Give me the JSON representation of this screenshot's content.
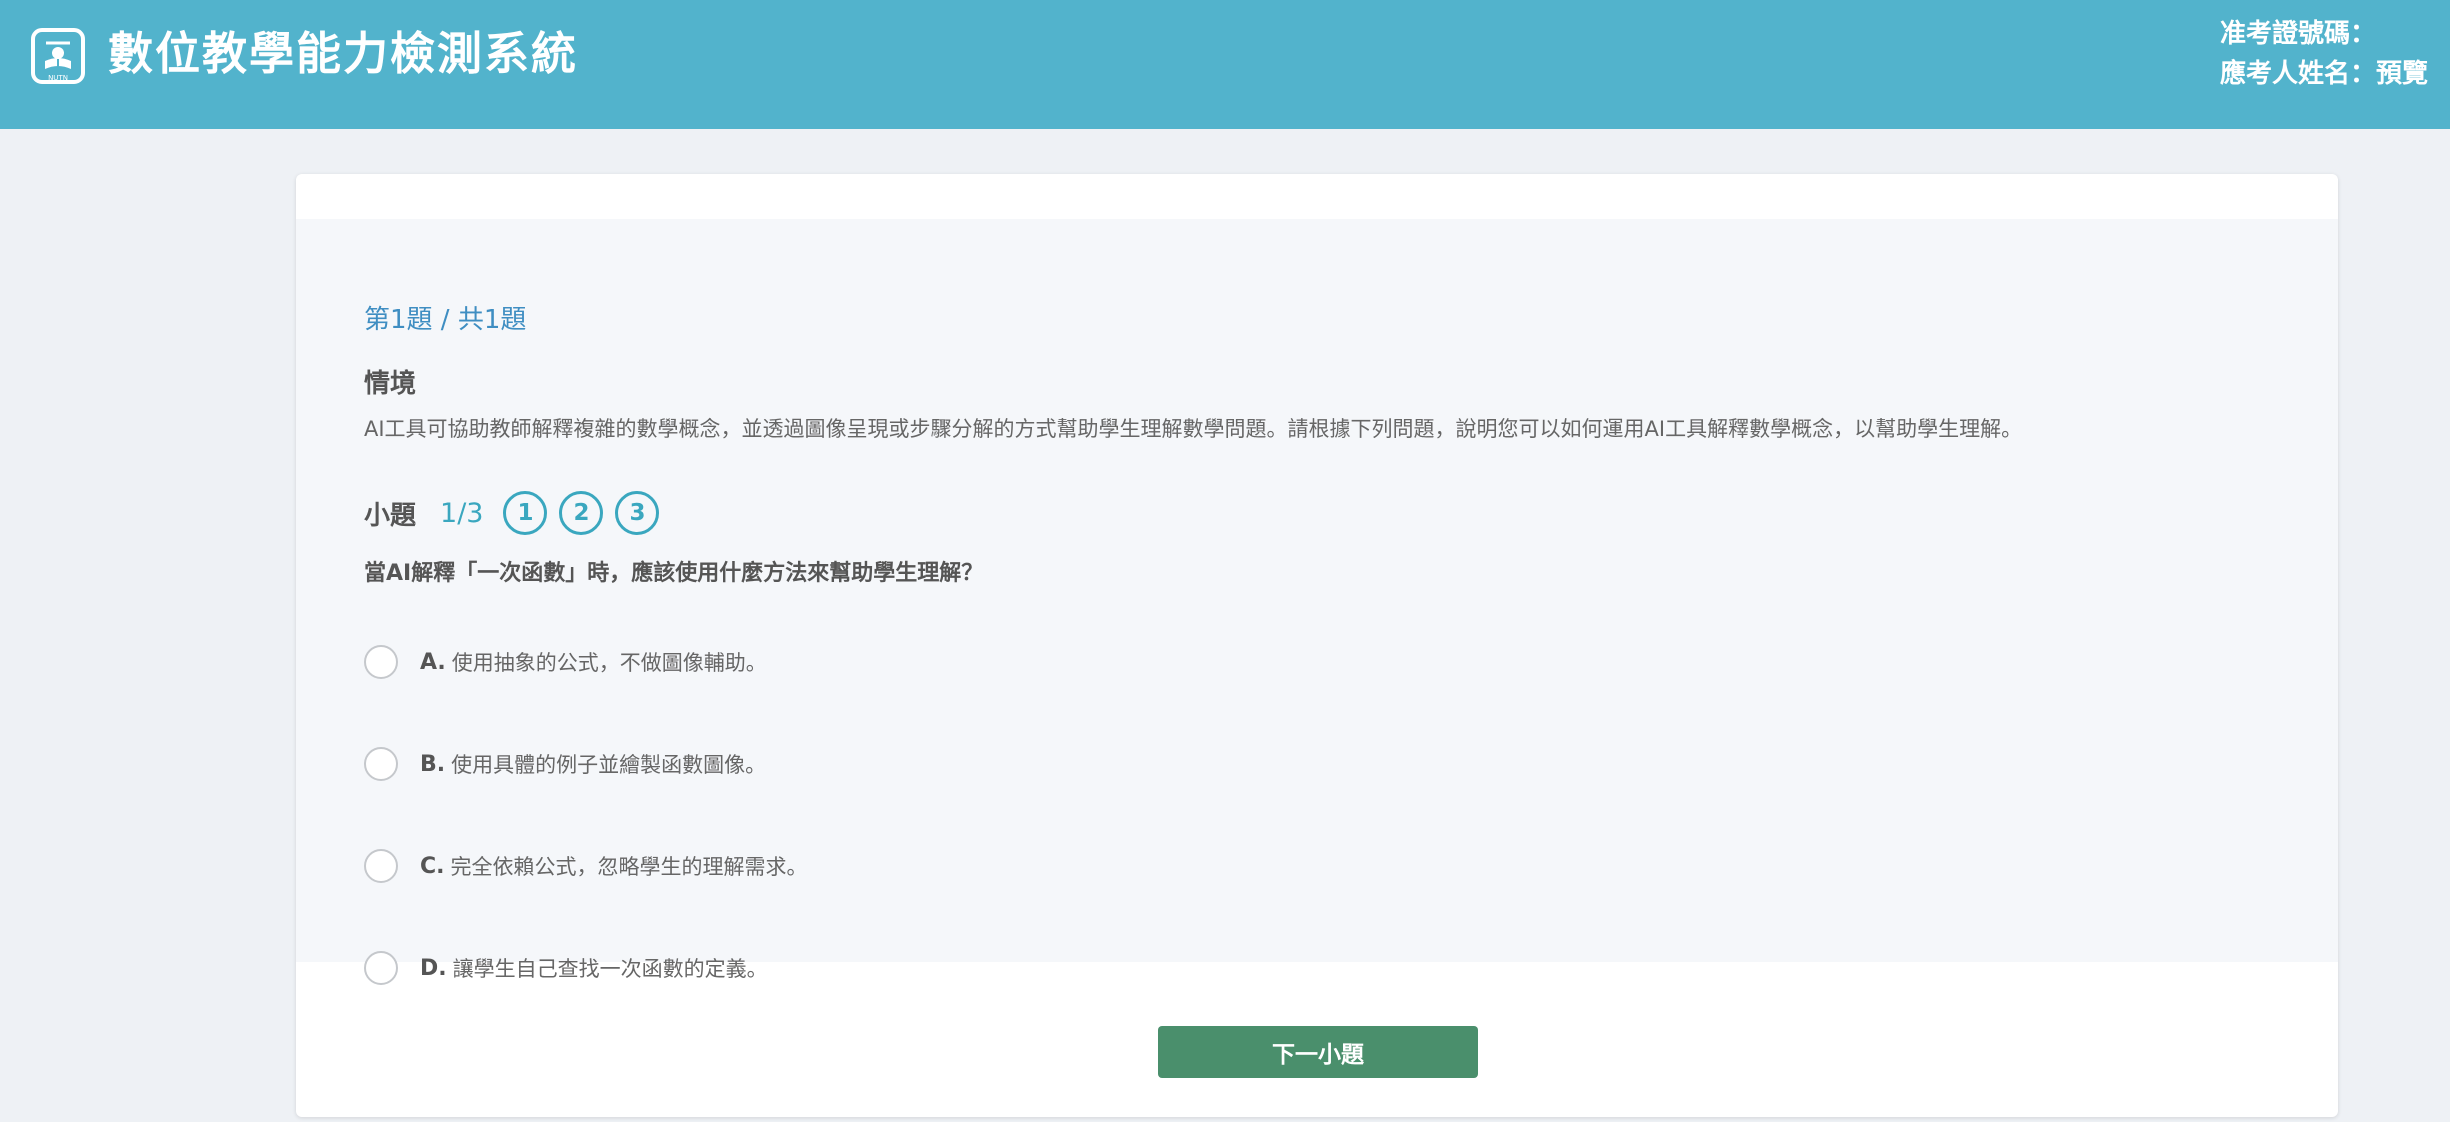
{
  "header": {
    "title": "數位教學能力檢測系統",
    "logo_icon": "book-mascot-icon",
    "logo_caption": "NUTN",
    "admission_label": "准考證號碼：",
    "admission_value": "",
    "name_label": "應考人姓名：",
    "name_value": "預覽",
    "background_color": "#52b3cc"
  },
  "exam": {
    "progress": "第1題 / 共1題",
    "scenario_label": "情境",
    "scenario_text": "AI工具可協助教師解釋複雜的數學概念，並透過圖像呈現或步驟分解的方式幫助學生理解數學問題。請根據下列問題，說明您可以如何運用AI工具解釋數學概念，以幫助學生理解。",
    "sub_label": "小題",
    "sub_progress": "1/3",
    "sub_nav": [
      "1",
      "2",
      "3"
    ],
    "question": "當AI解釋「一次函數」時，應該使用什麼方法來幫助學生理解？",
    "options": [
      {
        "letter": "A.",
        "text": "使用抽象的公式，不做圖像輔助。"
      },
      {
        "letter": "B.",
        "text": "使用具體的例子並繪製函數圖像。"
      },
      {
        "letter": "C.",
        "text": "完全依賴公式，忽略學生的理解需求。"
      },
      {
        "letter": "D.",
        "text": "讓學生自己查找一次函數的定義。"
      }
    ],
    "next_button": "下一小題",
    "accent_color": "#3aa7bf",
    "button_color": "#4a8f6c"
  }
}
